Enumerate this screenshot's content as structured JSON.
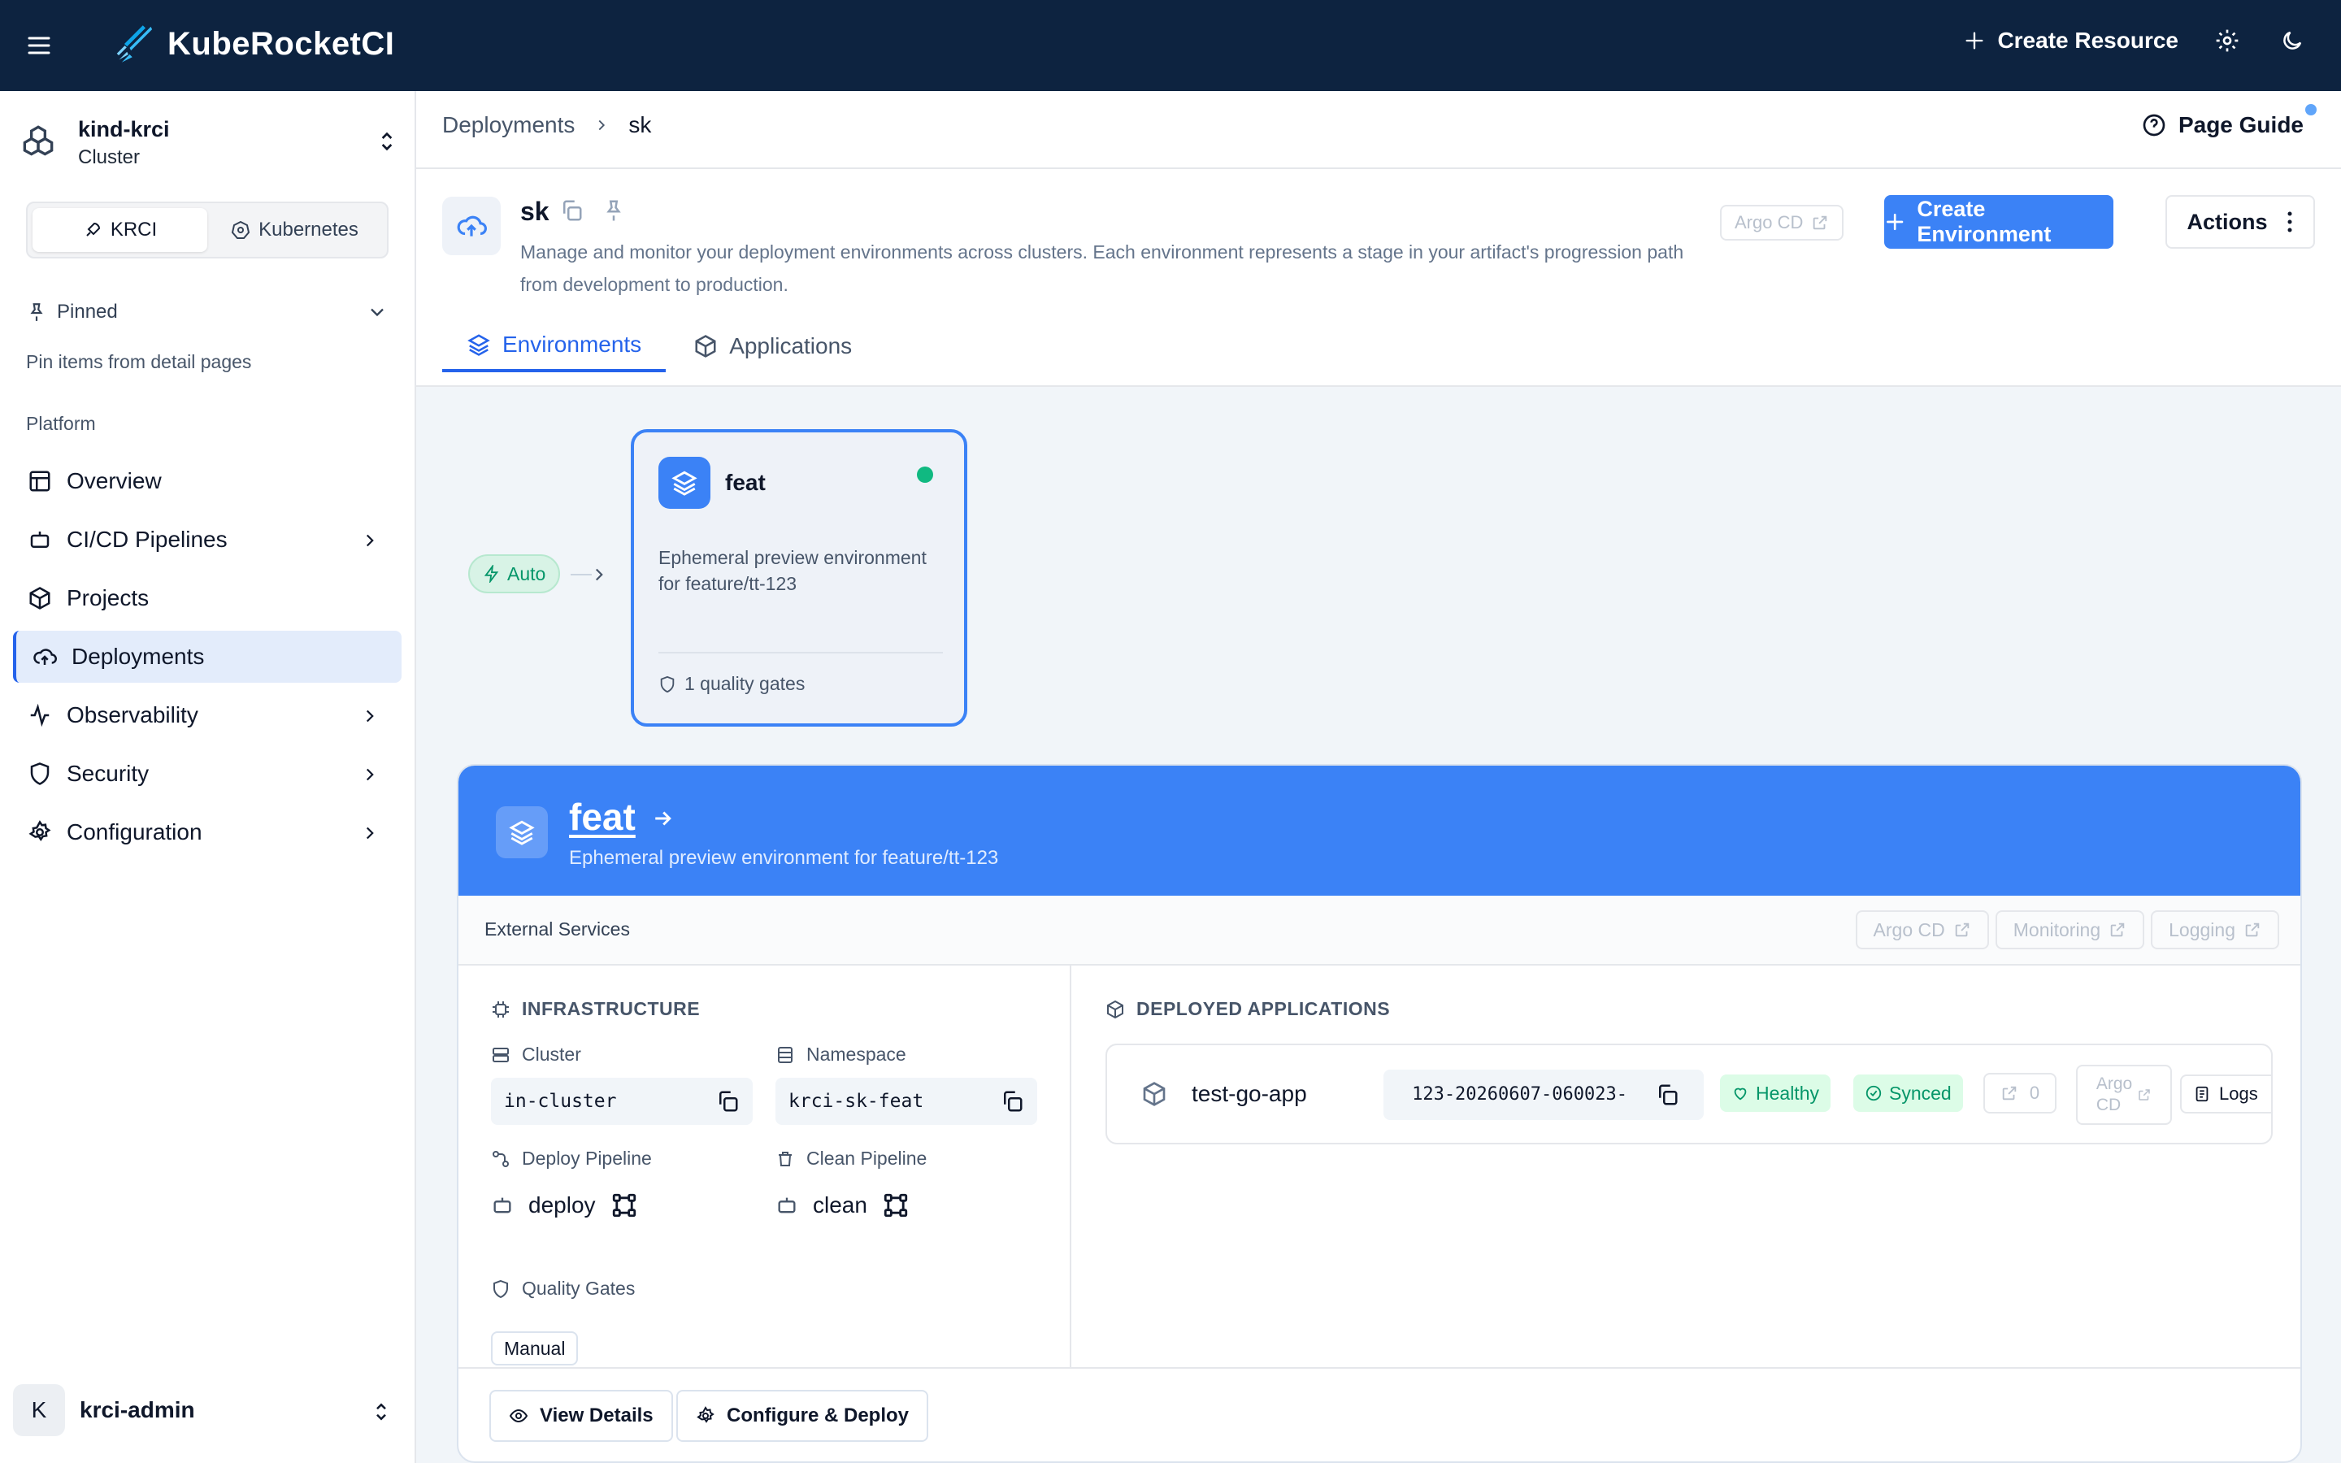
{
  "app": {
    "name": "KubeRocketCI"
  },
  "topbar": {
    "create_resource": "Create Resource"
  },
  "sidebar": {
    "cluster_name": "kind-krci",
    "cluster_type": "Cluster",
    "mode_tabs": [
      "KRCI",
      "Kubernetes"
    ],
    "pinned_label": "Pinned",
    "pinned_hint": "Pin items from detail pages",
    "section_label": "Platform",
    "items": [
      {
        "label": "Overview",
        "icon": "overview-icon"
      },
      {
        "label": "CI/CD Pipelines",
        "icon": "pipelines-icon"
      },
      {
        "label": "Projects",
        "icon": "box-icon"
      },
      {
        "label": "Deployments",
        "icon": "cloud-upload-icon"
      },
      {
        "label": "Observability",
        "icon": "activity-icon"
      },
      {
        "label": "Security",
        "icon": "shield-icon"
      },
      {
        "label": "Configuration",
        "icon": "gear-icon"
      }
    ],
    "user_initial": "K",
    "user_name": "krci-admin"
  },
  "breadcrumb": [
    "Deployments",
    "sk"
  ],
  "page_guide": "Page Guide",
  "page": {
    "title": "sk",
    "description": "Manage and monitor your deployment environments across clusters. Each environment represents a stage in your artifact's progression path from development to production.",
    "argo_cd": "Argo CD",
    "create_env": "Create Environment",
    "actions": "Actions"
  },
  "tabs": [
    "Environments",
    "Applications"
  ],
  "flow": {
    "trigger": "Auto",
    "card": {
      "name": "feat",
      "description": "Ephemeral preview environment for feature/tt-123",
      "gates": "1 quality gates",
      "status_color": "#10b981"
    }
  },
  "panel": {
    "name": "feat",
    "description": "Ephemeral preview environment for feature/tt-123",
    "external_label": "External Services",
    "external_buttons": [
      "Argo CD",
      "Monitoring",
      "Logging"
    ],
    "infra_title": "INFRASTRUCTURE",
    "cluster_label": "Cluster",
    "cluster_value": "in-cluster",
    "namespace_label": "Namespace",
    "namespace_value": "krci-sk-feat",
    "deploy_label": "Deploy Pipeline",
    "deploy_value": "deploy",
    "clean_label": "Clean Pipeline",
    "clean_value": "clean",
    "qg_label": "Quality Gates",
    "qg_value": "Manual",
    "deployed_title": "DEPLOYED APPLICATIONS",
    "app": {
      "name": "test-go-app",
      "version": "-123-20260607-060023",
      "health": "Healthy",
      "sync": "Synced",
      "ingress_count": "0",
      "argo_line1": "Argo",
      "argo_line2": "CD",
      "logs": "Logs"
    },
    "view_details": "View Details",
    "configure_deploy": "Configure & Deploy"
  },
  "colors": {
    "topbar": "#0d2340",
    "accent": "#3b82f6",
    "success": "#10b981"
  }
}
